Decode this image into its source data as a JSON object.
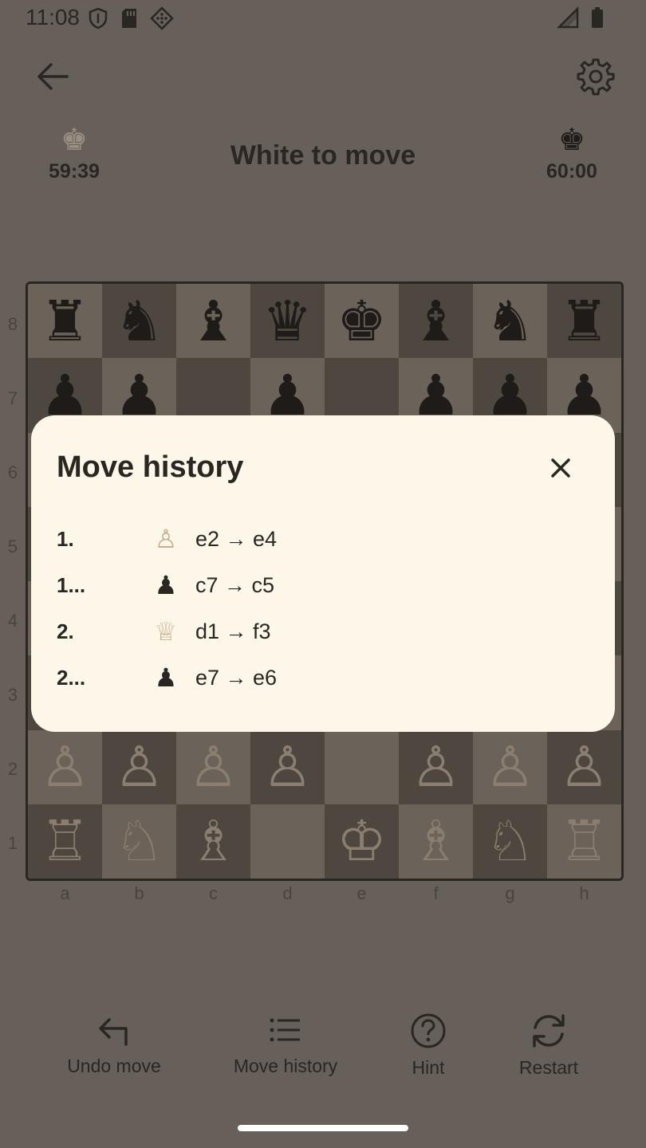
{
  "status_bar": {
    "time": "11:08",
    "icons": [
      "shield-icon",
      "sd-card-icon",
      "diamond-grid-icon",
      "signal-icon",
      "battery-icon"
    ]
  },
  "header": {
    "back_icon": "back-arrow-icon",
    "settings_icon": "gear-icon",
    "turn_text": "White to move",
    "white_clock": "59:39",
    "black_clock": "60:00"
  },
  "board": {
    "ranks": [
      "8",
      "7",
      "6",
      "5",
      "4",
      "3",
      "2",
      "1"
    ],
    "files": [
      "a",
      "b",
      "c",
      "d",
      "e",
      "f",
      "g",
      "h"
    ],
    "rows": [
      [
        "♜",
        "♞",
        "♝",
        "♛",
        "♚",
        "♝",
        "♞",
        "♜"
      ],
      [
        "♟",
        "♟",
        "",
        "♟",
        "",
        "♟",
        "♟",
        "♟"
      ],
      [
        "",
        "",
        "",
        "",
        "",
        "",
        "",
        ""
      ],
      [
        "",
        "",
        "",
        "",
        "",
        "",
        "",
        ""
      ],
      [
        "",
        "",
        "",
        "",
        "",
        "",
        "",
        ""
      ],
      [
        "",
        "",
        "",
        "",
        "",
        "",
        "",
        ""
      ],
      [
        "♙",
        "♙",
        "♙",
        "♙",
        "",
        "♙",
        "♙",
        "♙"
      ],
      [
        "♖",
        "♘",
        "♗",
        "",
        "♔",
        "♗",
        "♘",
        "♖"
      ]
    ],
    "colors": {
      "light": "#6b625a",
      "dark": "#4e4740"
    }
  },
  "modal": {
    "title": "Move history",
    "close_icon": "close-icon",
    "moves": [
      {
        "num": "1.",
        "piece": "♙",
        "side": "w",
        "move": "e2 → e4"
      },
      {
        "num": "1...",
        "piece": "♟",
        "side": "b",
        "move": "c7 → c5"
      },
      {
        "num": "2.",
        "piece": "♕",
        "side": "w",
        "move": "d1 → f3"
      },
      {
        "num": "2...",
        "piece": "♟",
        "side": "b",
        "move": "e7 → e6"
      }
    ]
  },
  "actions": {
    "undo": "Undo move",
    "history": "Move history",
    "hint": "Hint",
    "restart": "Restart"
  }
}
